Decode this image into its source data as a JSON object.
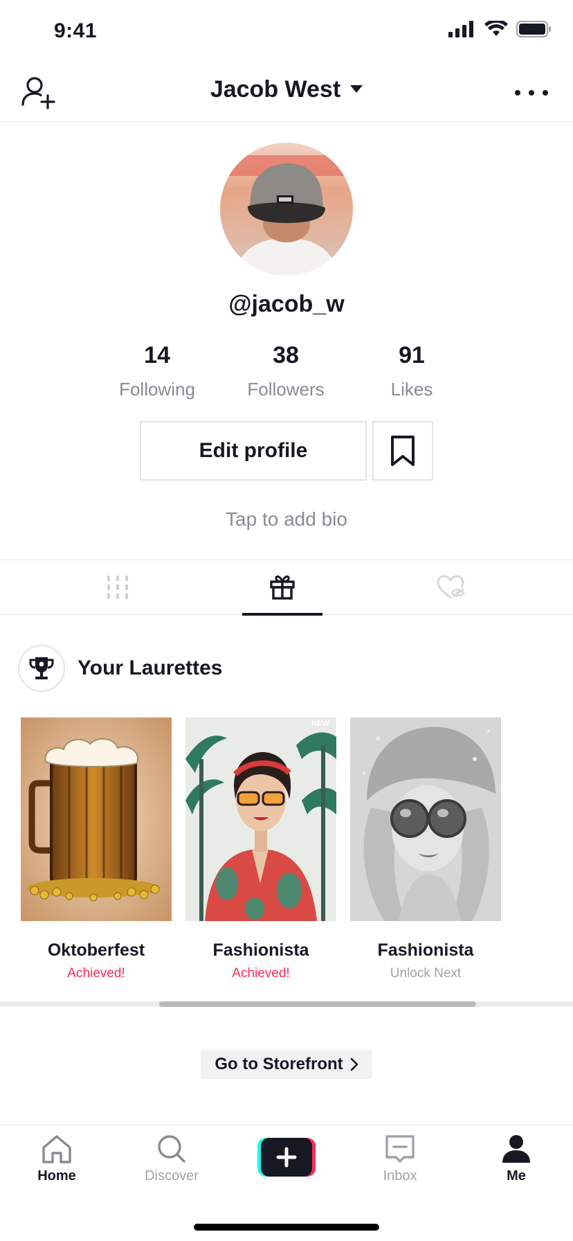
{
  "status_bar": {
    "time": "9:41"
  },
  "header": {
    "title": "Jacob West"
  },
  "profile": {
    "handle": "@jacob_w",
    "stats": [
      {
        "value": "14",
        "label": "Following"
      },
      {
        "value": "38",
        "label": "Followers"
      },
      {
        "value": "91",
        "label": "Likes"
      }
    ],
    "edit_label": "Edit profile",
    "bio_placeholder": "Tap to add bio"
  },
  "tabs": {
    "items": [
      {
        "name": "videos",
        "icon": "grid-icon",
        "active": false
      },
      {
        "name": "laurettes",
        "icon": "gift-icon",
        "active": true
      },
      {
        "name": "liked",
        "icon": "hidden-heart-icon",
        "active": false
      }
    ]
  },
  "laurettes": {
    "title": "Your Laurettes",
    "cards": [
      {
        "name": "Oktoberfest",
        "status": "Achieved!",
        "achieved": true
      },
      {
        "name": "Fashionista",
        "status": "Achieved!",
        "achieved": true,
        "badge": "NEW"
      },
      {
        "name": "Fashionista",
        "status": "Unlock Next",
        "achieved": false
      }
    ]
  },
  "storefront_label": "Go to Storefront",
  "bottom_nav": {
    "items": [
      {
        "label": "Home",
        "active": true
      },
      {
        "label": "Discover",
        "active": false
      },
      {
        "label": "Inbox",
        "active": false
      },
      {
        "label": "Me",
        "active": true
      }
    ]
  },
  "colors": {
    "accent": "#fe2c55",
    "cyan": "#25f4ee",
    "text": "#161823",
    "muted": "#8a8b91"
  }
}
